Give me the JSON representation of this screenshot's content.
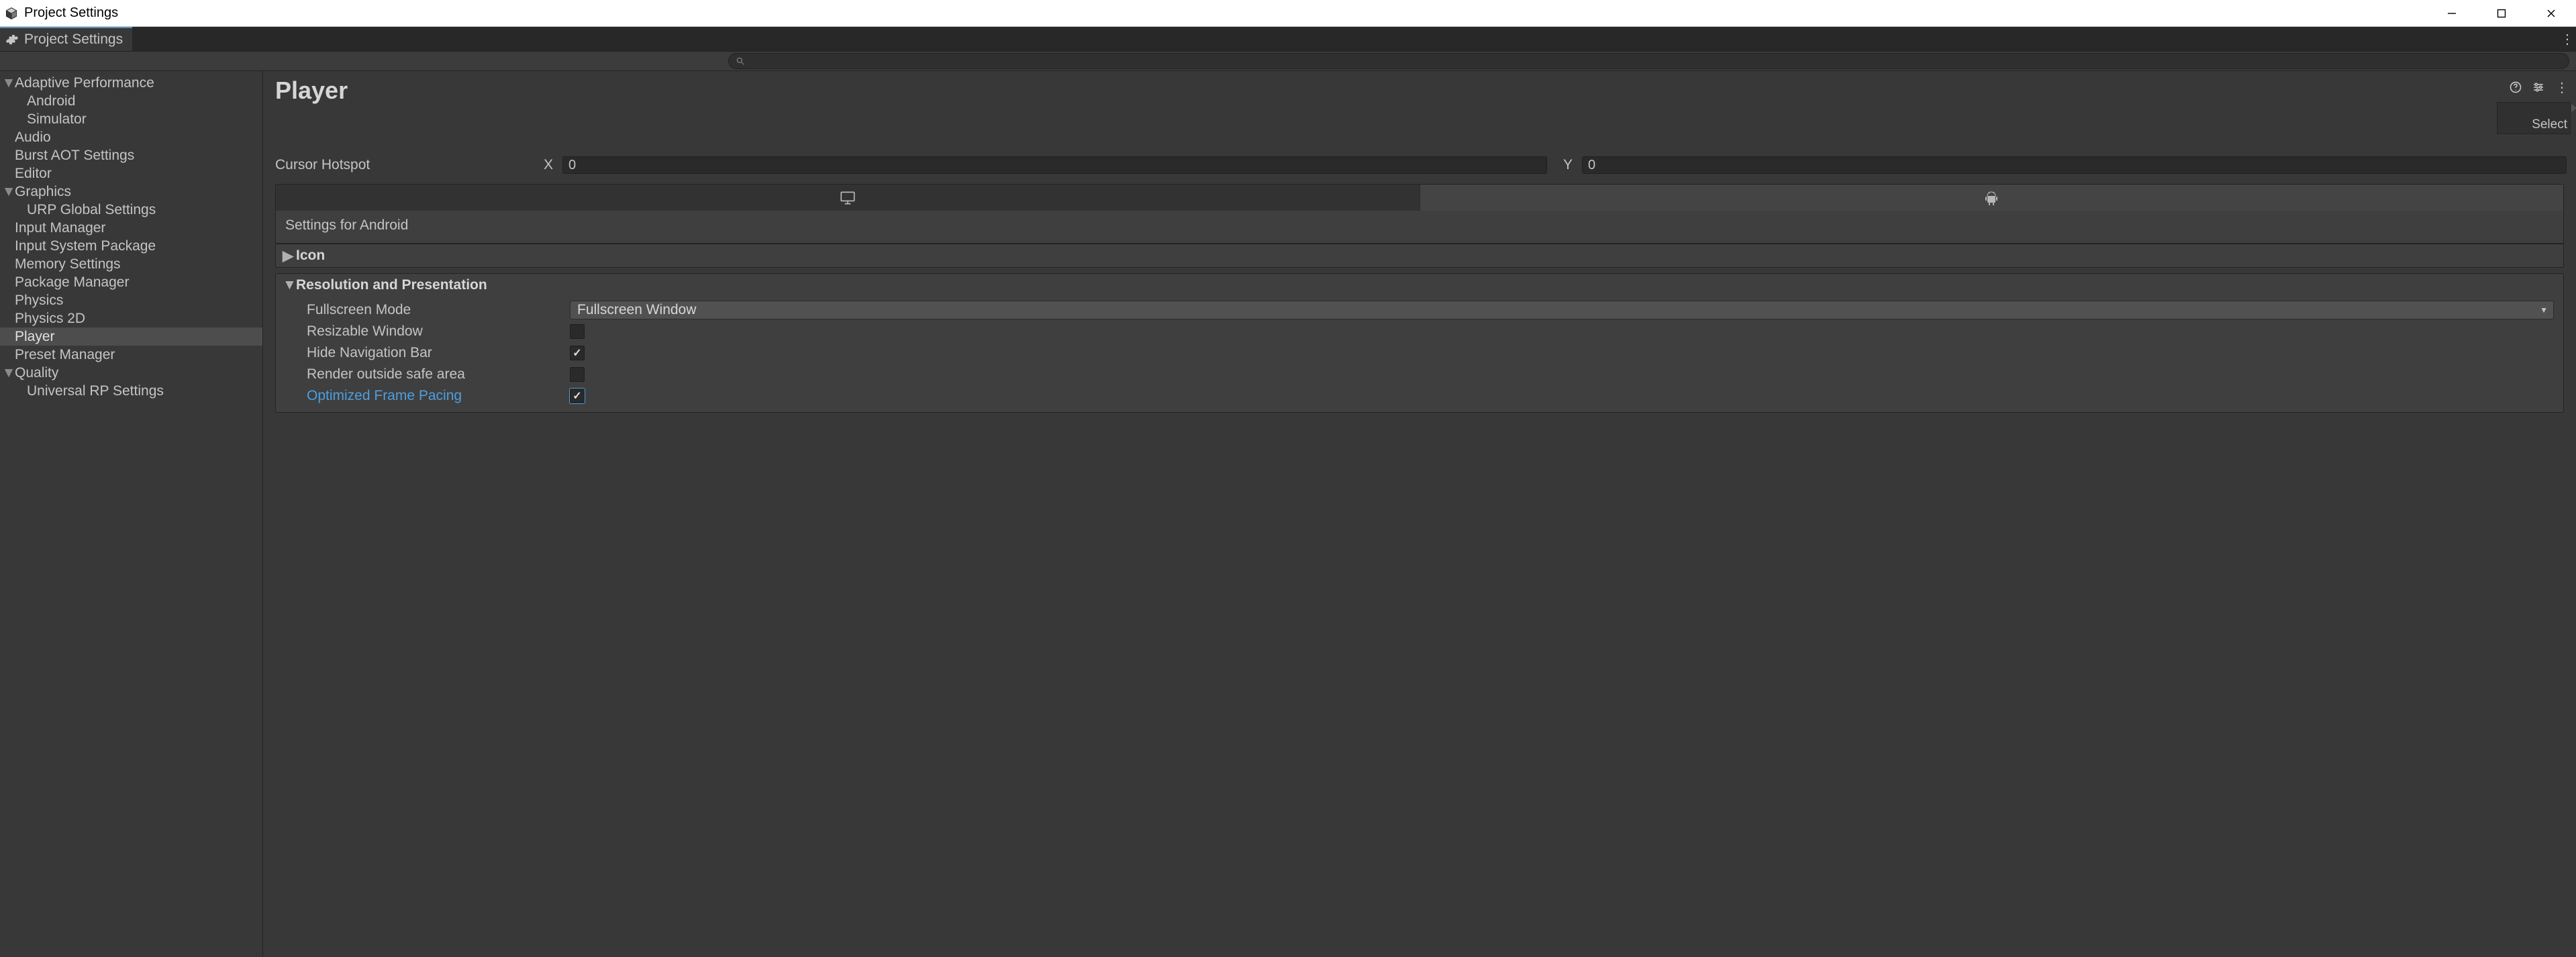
{
  "os_window": {
    "title": "Project Settings"
  },
  "tab": {
    "title": "Project Settings"
  },
  "search": {
    "value": ""
  },
  "sidebar": {
    "items": [
      {
        "label": "Adaptive Performance",
        "expandable": true,
        "expanded": true,
        "depth": 0
      },
      {
        "label": "Android",
        "depth": 1
      },
      {
        "label": "Simulator",
        "depth": 1
      },
      {
        "label": "Audio",
        "depth": 0
      },
      {
        "label": "Burst AOT Settings",
        "depth": 0
      },
      {
        "label": "Editor",
        "depth": 0
      },
      {
        "label": "Graphics",
        "expandable": true,
        "expanded": true,
        "depth": 0
      },
      {
        "label": "URP Global Settings",
        "depth": 1
      },
      {
        "label": "Input Manager",
        "depth": 0
      },
      {
        "label": "Input System Package",
        "depth": 0
      },
      {
        "label": "Memory Settings",
        "depth": 0
      },
      {
        "label": "Package Manager",
        "depth": 0
      },
      {
        "label": "Physics",
        "depth": 0
      },
      {
        "label": "Physics 2D",
        "depth": 0
      },
      {
        "label": "Player",
        "depth": 0,
        "selected": true
      },
      {
        "label": "Preset Manager",
        "depth": 0
      },
      {
        "label": "Quality",
        "expandable": true,
        "expanded": true,
        "depth": 0
      },
      {
        "label": "Universal RP Settings",
        "depth": 1
      }
    ]
  },
  "page": {
    "title": "Player",
    "select_button": "Select",
    "cursor_hotspot": {
      "label": "Cursor Hotspot",
      "x_label": "X",
      "x_value": "0",
      "y_label": "Y",
      "y_value": "0"
    },
    "platform_tabs": {
      "active_index": 1,
      "tabs": [
        "desktop",
        "android"
      ]
    },
    "settings_for_label": "Settings for Android",
    "foldouts": {
      "icon": {
        "title": "Icon",
        "expanded": false
      },
      "resolution": {
        "title": "Resolution and Presentation",
        "expanded": true,
        "fullscreen_mode": {
          "label": "Fullscreen Mode",
          "value": "Fullscreen Window"
        },
        "resizable_window": {
          "label": "Resizable Window",
          "checked": false
        },
        "hide_nav_bar": {
          "label": "Hide Navigation Bar",
          "checked": true
        },
        "render_outside": {
          "label": "Render outside safe area",
          "checked": false
        },
        "optimized_pacing": {
          "label": "Optimized Frame Pacing",
          "checked": true,
          "highlighted": true
        }
      }
    }
  }
}
